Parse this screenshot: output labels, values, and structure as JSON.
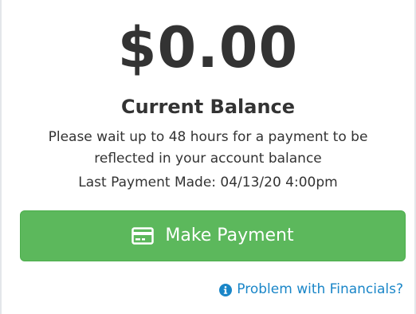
{
  "balance": {
    "amount": "$0.00",
    "label": "Current Balance",
    "note": "Please wait up to 48 hours for a payment to be reflected in your account balance",
    "last_payment": "Last Payment Made: 04/13/20 4:00pm"
  },
  "actions": {
    "make_payment_label": "Make Payment",
    "make_payment_icon": "credit-card-icon",
    "help_link_label": "Problem with Financials?",
    "help_link_icon": "info-circle-icon"
  },
  "colors": {
    "text": "#333333",
    "button": "#5cb85c",
    "link": "#1a86c8"
  }
}
